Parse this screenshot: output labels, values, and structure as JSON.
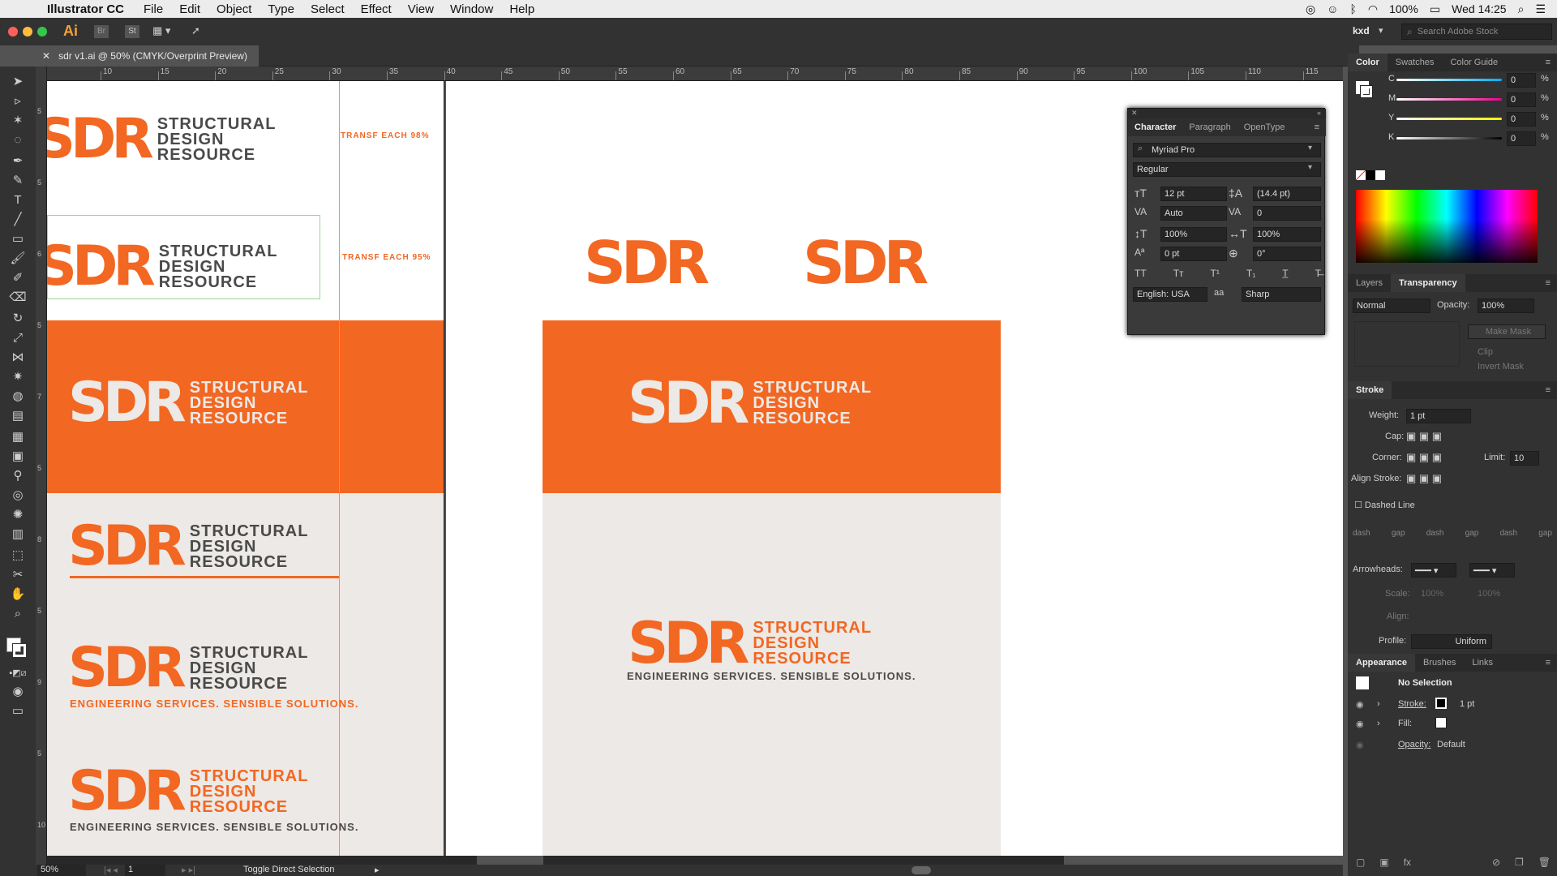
{
  "menubar": {
    "app": "Illustrator CC",
    "items": [
      "File",
      "Edit",
      "Object",
      "Type",
      "Select",
      "Effect",
      "View",
      "Window",
      "Help"
    ],
    "battery": "100%",
    "clock": "Wed 14:25"
  },
  "appbar": {
    "ai_logo": "Ai",
    "br": "Br",
    "st": "St",
    "workspace": "kxd",
    "stock_search_placeholder": "Search Adobe Stock"
  },
  "document": {
    "tab_title": "sdr v1.ai @ 50% (CMYK/Overprint Preview)"
  },
  "ruler": {
    "labels": [
      "10",
      "15",
      "20",
      "25",
      "30",
      "35",
      "40",
      "45",
      "50",
      "55",
      "60",
      "65",
      "70",
      "75",
      "80",
      "85",
      "90",
      "95",
      "100",
      "105",
      "110",
      "115"
    ],
    "vlabels": [
      "5",
      "5",
      "6",
      "5",
      "7",
      "5",
      "8",
      "5",
      "9",
      "5",
      "10"
    ]
  },
  "artwork": {
    "sdr": "SDR",
    "lines": [
      "STRUCTURAL",
      "DESIGN",
      "RESOURCE"
    ],
    "tagline": "ENGINEERING SERVICES. SENSIBLE SOLUTIONS.",
    "note98": "TRANSF EACH 98%",
    "note95": "TRANSF EACH 95%",
    "orange": "#f26722",
    "dark": "#4a4a4a",
    "light": "#ece9e6"
  },
  "character": {
    "tabs": [
      "Character",
      "Paragraph",
      "OpenType"
    ],
    "font": "Myriad Pro",
    "style": "Regular",
    "size": "12 pt",
    "leading": "(14.4 pt)",
    "kerning": "Auto",
    "tracking": "0",
    "vscale": "100%",
    "hscale": "100%",
    "baseline": "0 pt",
    "rotation": "0°",
    "language": "English: USA",
    "aa": "Sharp",
    "aa_icon": "aa"
  },
  "color": {
    "tabs": [
      "Color",
      "Swatches",
      "Color Guide"
    ],
    "channels": [
      {
        "name": "C",
        "value": "0"
      },
      {
        "name": "M",
        "value": "0"
      },
      {
        "name": "Y",
        "value": "0"
      },
      {
        "name": "K",
        "value": "0"
      }
    ],
    "unit": "%"
  },
  "transparency": {
    "tabs": [
      "Layers",
      "Transparency"
    ],
    "mode": "Normal",
    "opacity_label": "Opacity:",
    "opacity": "100%",
    "make_mask": "Make Mask",
    "clip": "Clip",
    "invert": "Invert Mask"
  },
  "stroke": {
    "title": "Stroke",
    "weight_label": "Weight:",
    "weight": "1 pt",
    "cap_label": "Cap:",
    "corner_label": "Corner:",
    "limit_label": "Limit:",
    "limit": "10",
    "align_label": "Align Stroke:",
    "dashed": "Dashed Line",
    "dash_labels": [
      "dash",
      "gap",
      "dash",
      "gap",
      "dash",
      "gap"
    ],
    "arrowheads": "Arrowheads:",
    "scale": "Scale:",
    "scale_a": "100%",
    "scale_b": "100%",
    "align2": "Align:",
    "profile_label": "Profile:",
    "profile": "Uniform"
  },
  "appearance": {
    "tabs": [
      "Appearance",
      "Brushes",
      "Links"
    ],
    "selection": "No Selection",
    "stroke_label": "Stroke:",
    "stroke_val": "1 pt",
    "fill_label": "Fill:",
    "opacity_label": "Opacity:",
    "opacity_val": "Default"
  },
  "status": {
    "zoom": "50%",
    "page": "1",
    "tool": "Toggle Direct Selection"
  }
}
